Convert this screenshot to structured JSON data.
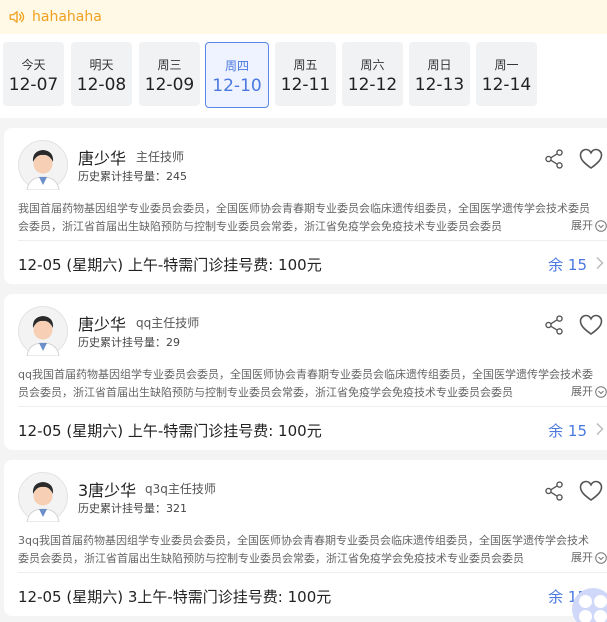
{
  "notice": {
    "text": "hahahaha",
    "icon": "speaker-icon"
  },
  "dates": [
    {
      "weekday": "今天",
      "date": "12-07",
      "active": false
    },
    {
      "weekday": "明天",
      "date": "12-08",
      "active": false
    },
    {
      "weekday": "周三",
      "date": "12-09",
      "active": false
    },
    {
      "weekday": "周四",
      "date": "12-10",
      "active": true
    },
    {
      "weekday": "周五",
      "date": "12-11",
      "active": false
    },
    {
      "weekday": "周六",
      "date": "12-12",
      "active": false
    },
    {
      "weekday": "周日",
      "date": "12-13",
      "active": false
    },
    {
      "weekday": "周一",
      "date": "12-14",
      "active": false
    }
  ],
  "expand_label": "展开",
  "doctors": [
    {
      "name": "唐少华",
      "title": "主任技师",
      "history": "历史累计挂号量：245",
      "intro": "我国首届药物基因组学专业委员会委员，全国医师协会青春期专业委员会临床遗传组委员，全国医学遗传学会技术委员会委员，浙江省首届出生缺陷预防与控制专业委员会常委，浙江省免疫学会免疫技术专业委员会委员",
      "slot": "12-05 (星期六)  上午-特需门诊挂号费: 100元",
      "remain": "余 15"
    },
    {
      "name": "唐少华",
      "title": "qq主任技师",
      "history": "历史累计挂号量：29",
      "intro": "qq我国首届药物基因组学专业委员会委员，全国医师协会青春期专业委员会临床遗传组委员，全国医学遗传学会技术委员会委员，浙江省首届出生缺陷预防与控制专业委员会常委，浙江省免疫学会免疫技术专业委员会委员",
      "slot": "12-05 (星期六)  上午-特需门诊挂号费: 100元",
      "remain": "余 15"
    },
    {
      "name": "3唐少华",
      "title": "q3q主任技师",
      "history": "历史累计挂号量：321",
      "intro": "3qq我国首届药物基因组学专业委员会委员，全国医师协会青春期专业委员会临床遗传组委员，全国医学遗传学会技术委员会委员，浙江省首届出生缺陷预防与控制专业委员会常委，浙江省免疫学会免疫技术专业委员会委员",
      "slot": "12-05 (星期六)  3上午-特需门诊挂号费: 100元",
      "remain": "余 15"
    }
  ],
  "colors": {
    "accent": "#4a78e0",
    "notice_text": "#f0a020",
    "notice_bg": "#fff9e6"
  }
}
